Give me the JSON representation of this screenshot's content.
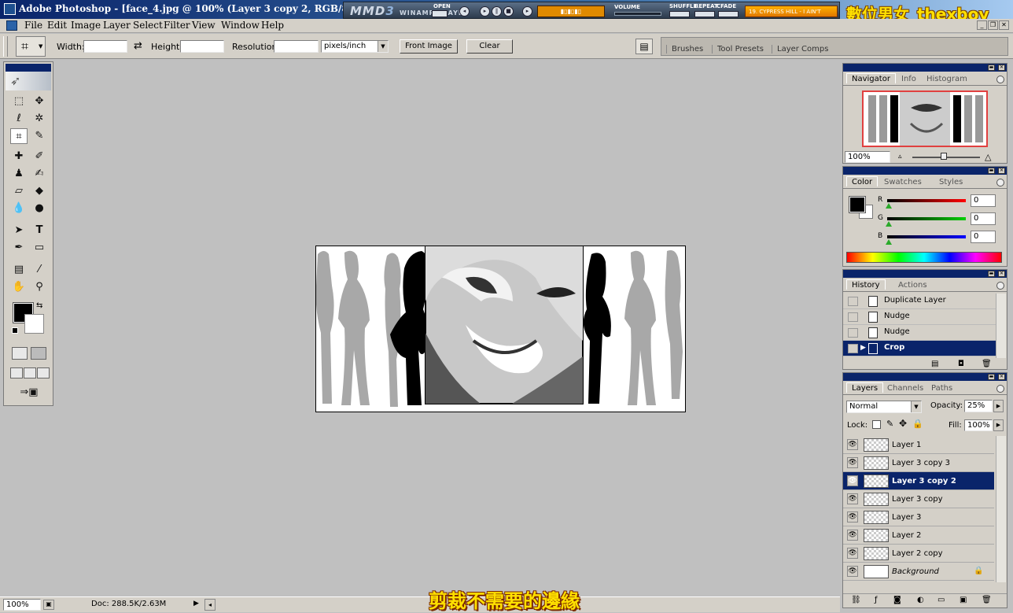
{
  "window": {
    "title": "Adobe Photoshop - [face_4.jpg @ 100% (Layer 3 copy 2, RGB/8)]"
  },
  "player": {
    "logo": "MMD",
    "logo_version": "3",
    "logo_sub": "WINAMP-PLAYER",
    "open_label": "OPEN",
    "volume_label": "VOLUME",
    "shuffle_label": "SHUFFLE",
    "repeat_label": "REPEAT",
    "cfade_label": "CFADE",
    "track": "19. CYPRESS HILL - I AIN'T"
  },
  "watermark": "數位男女_thexboy",
  "menu": {
    "items": [
      "File",
      "Edit",
      "Image",
      "Layer",
      "Select",
      "Filter",
      "View",
      "Window",
      "Help"
    ]
  },
  "options": {
    "width_label": "Width:",
    "width_value": "",
    "height_label": "Height:",
    "height_value": "",
    "resolution_label": "Resolution:",
    "resolution_value": "",
    "units_value": "pixels/inch",
    "front_image_label": "Front Image",
    "clear_label": "Clear",
    "palette_well_tabs": [
      "Brushes",
      "Tool Presets",
      "Layer Comps"
    ]
  },
  "navigator": {
    "tabs": [
      "Navigator",
      "Info",
      "Histogram"
    ],
    "zoom_value": "100%"
  },
  "color": {
    "tabs": [
      "Color",
      "Swatches",
      "Styles"
    ],
    "r_label": "R",
    "g_label": "G",
    "b_label": "B",
    "r_value": "0",
    "g_value": "0",
    "b_value": "0"
  },
  "history": {
    "tabs": [
      "History",
      "Actions"
    ],
    "items": [
      "Duplicate Layer",
      "Nudge",
      "Nudge",
      "Crop"
    ]
  },
  "layers": {
    "tabs": [
      "Layers",
      "Channels",
      "Paths"
    ],
    "blend_mode": "Normal",
    "opacity_label": "Opacity:",
    "opacity_value": "25%",
    "lock_label": "Lock:",
    "fill_label": "Fill:",
    "fill_value": "100%",
    "items": [
      "Layer 1",
      "Layer 3 copy 3",
      "Layer 3 copy 2",
      "Layer 3 copy",
      "Layer 3",
      "Layer 2",
      "Layer 2 copy",
      "Background"
    ]
  },
  "status": {
    "zoom": "100%",
    "doc_info": "Doc: 288.5K/2.63M"
  },
  "subtitle": "剪裁不需要的邊緣",
  "colors": {
    "title_blue": "#0a246a",
    "chrome_gray": "#d4d0c8",
    "workspace_gray": "#c0c0c0",
    "caption_yellow": "#ffe000"
  }
}
